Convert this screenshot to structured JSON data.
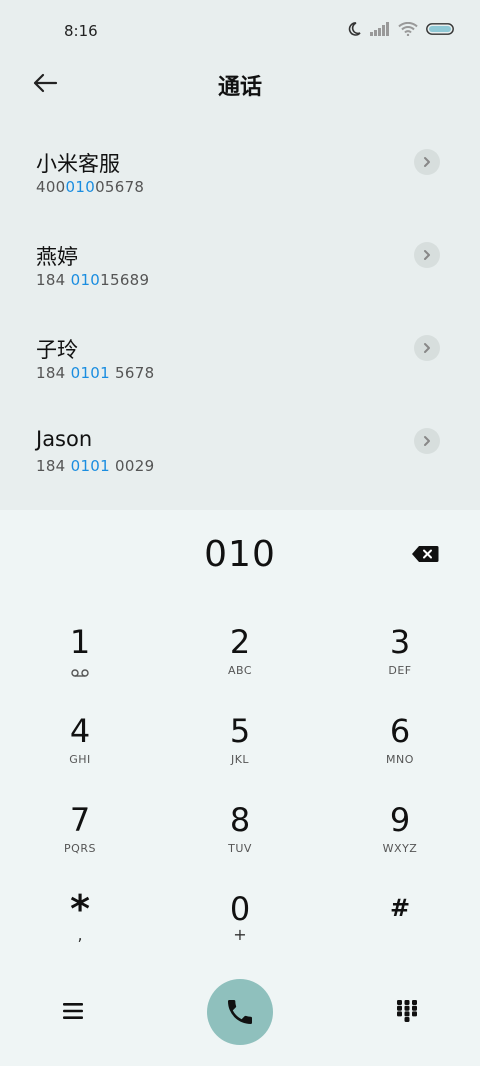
{
  "status_bar": {
    "time": "8:16"
  },
  "header": {
    "title": "通话"
  },
  "contacts": [
    {
      "name": "小米客服",
      "number_pre": "400",
      "number_match": "010",
      "number_post": "05678"
    },
    {
      "name": "燕婷",
      "number_pre": "184 ",
      "number_match": "010",
      "number_post": "15689"
    },
    {
      "name": "子玲",
      "number_pre": "184 ",
      "number_match": "0101",
      "number_post": " 5678"
    },
    {
      "name": "Jason",
      "number_pre": "184 ",
      "number_match": "0101",
      "number_post": " 0029"
    }
  ],
  "dialer": {
    "display": "010",
    "keys": [
      {
        "digit": "1",
        "letters": ""
      },
      {
        "digit": "2",
        "letters": "ABC"
      },
      {
        "digit": "3",
        "letters": "DEF"
      },
      {
        "digit": "4",
        "letters": "GHI"
      },
      {
        "digit": "5",
        "letters": "JKL"
      },
      {
        "digit": "6",
        "letters": "MNO"
      },
      {
        "digit": "7",
        "letters": "PQRS"
      },
      {
        "digit": "8",
        "letters": "TUV"
      },
      {
        "digit": "9",
        "letters": "WXYZ"
      },
      {
        "digit": "*",
        "letters": ","
      },
      {
        "digit": "0",
        "letters": "+"
      },
      {
        "digit": "#",
        "letters": ""
      }
    ]
  },
  "colors": {
    "accent": "#1a8de0",
    "call_button": "#8fc0bd",
    "list_bg": "#e8eeee",
    "dialer_bg": "#eff5f5"
  }
}
